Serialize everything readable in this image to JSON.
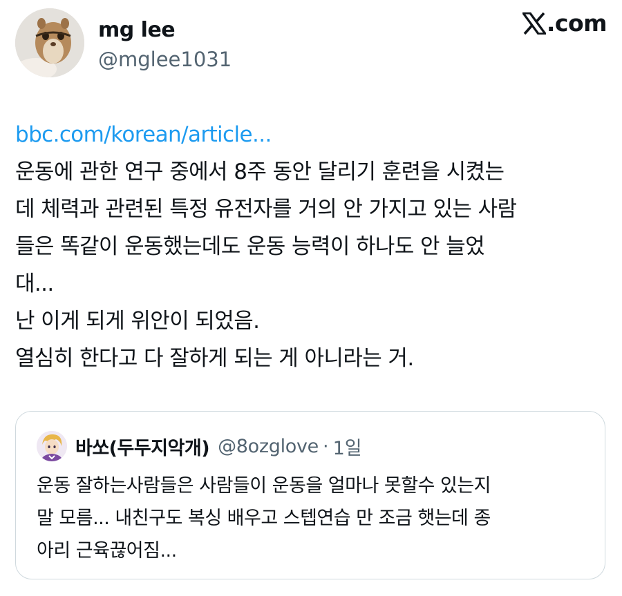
{
  "author": {
    "display_name": "mg lee",
    "handle": "@mglee1031",
    "avatar_icon": "chipmunk-avatar"
  },
  "brand": {
    "logo_icon": "x-logo-icon",
    "text": ".com"
  },
  "tweet": {
    "link_text": "bbc.com/korean/article...",
    "lines": [
      "운동에 관한 연구 중에서 8주 동안 달리기 훈련을 시켰는",
      "데 체력과 관련된 특정 유전자를 거의 안 가지고 있는 사람",
      "들은 똑같이 운동했는데도 운동 능력이 하나도 안 늘었",
      "대...",
      "난 이게 되게 위안이 되었음.",
      "열심히 한다고 다 잘하게 되는 게 아니라는 거."
    ]
  },
  "quoted_tweet": {
    "display_name": "바쏘(두두지악개)",
    "handle": "@8ozglove",
    "separator": "·",
    "time": "1일",
    "avatar_icon": "anime-character-avatar",
    "lines": [
      "운동 잘하는사람들은 사람들이 운동을 얼마나 못할수 있는지",
      "말 모름... 내친구도 복싱 배우고 스텝연습 만 조금 햇는데 종",
      "아리 근육끊어짐..."
    ]
  },
  "colors": {
    "link": "#1d9bf0",
    "text": "#0f1419",
    "secondary": "#536471",
    "border": "#cfd9de"
  }
}
